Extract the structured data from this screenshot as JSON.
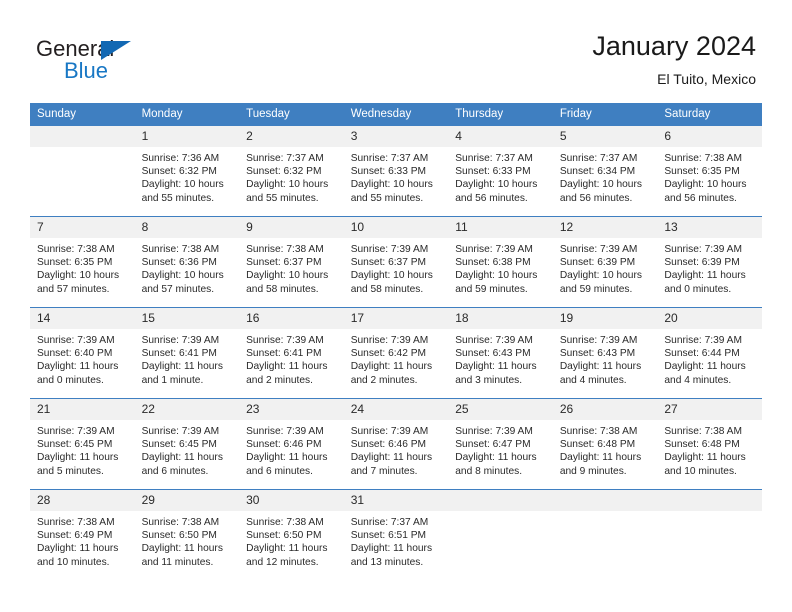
{
  "brand": {
    "name_top": "General",
    "name_bottom": "Blue",
    "color_dark": "#231f20",
    "color_blue": "#1877c4"
  },
  "header": {
    "title": "January 2024",
    "location": "El Tuito, Mexico"
  },
  "theme": {
    "header_row_bg": "#3f7fc1",
    "daynum_bg": "#f1f1f1",
    "text": "#2a2a2a"
  },
  "weekday_headers": [
    "Sunday",
    "Monday",
    "Tuesday",
    "Wednesday",
    "Thursday",
    "Friday",
    "Saturday"
  ],
  "weeks": [
    [
      {
        "day": "",
        "sunrise": "",
        "sunset": "",
        "daylight_line1": "",
        "daylight_line2": ""
      },
      {
        "day": "1",
        "sunrise": "Sunrise: 7:36 AM",
        "sunset": "Sunset: 6:32 PM",
        "daylight_line1": "Daylight: 10 hours",
        "daylight_line2": "and 55 minutes."
      },
      {
        "day": "2",
        "sunrise": "Sunrise: 7:37 AM",
        "sunset": "Sunset: 6:32 PM",
        "daylight_line1": "Daylight: 10 hours",
        "daylight_line2": "and 55 minutes."
      },
      {
        "day": "3",
        "sunrise": "Sunrise: 7:37 AM",
        "sunset": "Sunset: 6:33 PM",
        "daylight_line1": "Daylight: 10 hours",
        "daylight_line2": "and 55 minutes."
      },
      {
        "day": "4",
        "sunrise": "Sunrise: 7:37 AM",
        "sunset": "Sunset: 6:33 PM",
        "daylight_line1": "Daylight: 10 hours",
        "daylight_line2": "and 56 minutes."
      },
      {
        "day": "5",
        "sunrise": "Sunrise: 7:37 AM",
        "sunset": "Sunset: 6:34 PM",
        "daylight_line1": "Daylight: 10 hours",
        "daylight_line2": "and 56 minutes."
      },
      {
        "day": "6",
        "sunrise": "Sunrise: 7:38 AM",
        "sunset": "Sunset: 6:35 PM",
        "daylight_line1": "Daylight: 10 hours",
        "daylight_line2": "and 56 minutes."
      }
    ],
    [
      {
        "day": "7",
        "sunrise": "Sunrise: 7:38 AM",
        "sunset": "Sunset: 6:35 PM",
        "daylight_line1": "Daylight: 10 hours",
        "daylight_line2": "and 57 minutes."
      },
      {
        "day": "8",
        "sunrise": "Sunrise: 7:38 AM",
        "sunset": "Sunset: 6:36 PM",
        "daylight_line1": "Daylight: 10 hours",
        "daylight_line2": "and 57 minutes."
      },
      {
        "day": "9",
        "sunrise": "Sunrise: 7:38 AM",
        "sunset": "Sunset: 6:37 PM",
        "daylight_line1": "Daylight: 10 hours",
        "daylight_line2": "and 58 minutes."
      },
      {
        "day": "10",
        "sunrise": "Sunrise: 7:39 AM",
        "sunset": "Sunset: 6:37 PM",
        "daylight_line1": "Daylight: 10 hours",
        "daylight_line2": "and 58 minutes."
      },
      {
        "day": "11",
        "sunrise": "Sunrise: 7:39 AM",
        "sunset": "Sunset: 6:38 PM",
        "daylight_line1": "Daylight: 10 hours",
        "daylight_line2": "and 59 minutes."
      },
      {
        "day": "12",
        "sunrise": "Sunrise: 7:39 AM",
        "sunset": "Sunset: 6:39 PM",
        "daylight_line1": "Daylight: 10 hours",
        "daylight_line2": "and 59 minutes."
      },
      {
        "day": "13",
        "sunrise": "Sunrise: 7:39 AM",
        "sunset": "Sunset: 6:39 PM",
        "daylight_line1": "Daylight: 11 hours",
        "daylight_line2": "and 0 minutes."
      }
    ],
    [
      {
        "day": "14",
        "sunrise": "Sunrise: 7:39 AM",
        "sunset": "Sunset: 6:40 PM",
        "daylight_line1": "Daylight: 11 hours",
        "daylight_line2": "and 0 minutes."
      },
      {
        "day": "15",
        "sunrise": "Sunrise: 7:39 AM",
        "sunset": "Sunset: 6:41 PM",
        "daylight_line1": "Daylight: 11 hours",
        "daylight_line2": "and 1 minute."
      },
      {
        "day": "16",
        "sunrise": "Sunrise: 7:39 AM",
        "sunset": "Sunset: 6:41 PM",
        "daylight_line1": "Daylight: 11 hours",
        "daylight_line2": "and 2 minutes."
      },
      {
        "day": "17",
        "sunrise": "Sunrise: 7:39 AM",
        "sunset": "Sunset: 6:42 PM",
        "daylight_line1": "Daylight: 11 hours",
        "daylight_line2": "and 2 minutes."
      },
      {
        "day": "18",
        "sunrise": "Sunrise: 7:39 AM",
        "sunset": "Sunset: 6:43 PM",
        "daylight_line1": "Daylight: 11 hours",
        "daylight_line2": "and 3 minutes."
      },
      {
        "day": "19",
        "sunrise": "Sunrise: 7:39 AM",
        "sunset": "Sunset: 6:43 PM",
        "daylight_line1": "Daylight: 11 hours",
        "daylight_line2": "and 4 minutes."
      },
      {
        "day": "20",
        "sunrise": "Sunrise: 7:39 AM",
        "sunset": "Sunset: 6:44 PM",
        "daylight_line1": "Daylight: 11 hours",
        "daylight_line2": "and 4 minutes."
      }
    ],
    [
      {
        "day": "21",
        "sunrise": "Sunrise: 7:39 AM",
        "sunset": "Sunset: 6:45 PM",
        "daylight_line1": "Daylight: 11 hours",
        "daylight_line2": "and 5 minutes."
      },
      {
        "day": "22",
        "sunrise": "Sunrise: 7:39 AM",
        "sunset": "Sunset: 6:45 PM",
        "daylight_line1": "Daylight: 11 hours",
        "daylight_line2": "and 6 minutes."
      },
      {
        "day": "23",
        "sunrise": "Sunrise: 7:39 AM",
        "sunset": "Sunset: 6:46 PM",
        "daylight_line1": "Daylight: 11 hours",
        "daylight_line2": "and 6 minutes."
      },
      {
        "day": "24",
        "sunrise": "Sunrise: 7:39 AM",
        "sunset": "Sunset: 6:46 PM",
        "daylight_line1": "Daylight: 11 hours",
        "daylight_line2": "and 7 minutes."
      },
      {
        "day": "25",
        "sunrise": "Sunrise: 7:39 AM",
        "sunset": "Sunset: 6:47 PM",
        "daylight_line1": "Daylight: 11 hours",
        "daylight_line2": "and 8 minutes."
      },
      {
        "day": "26",
        "sunrise": "Sunrise: 7:38 AM",
        "sunset": "Sunset: 6:48 PM",
        "daylight_line1": "Daylight: 11 hours",
        "daylight_line2": "and 9 minutes."
      },
      {
        "day": "27",
        "sunrise": "Sunrise: 7:38 AM",
        "sunset": "Sunset: 6:48 PM",
        "daylight_line1": "Daylight: 11 hours",
        "daylight_line2": "and 10 minutes."
      }
    ],
    [
      {
        "day": "28",
        "sunrise": "Sunrise: 7:38 AM",
        "sunset": "Sunset: 6:49 PM",
        "daylight_line1": "Daylight: 11 hours",
        "daylight_line2": "and 10 minutes."
      },
      {
        "day": "29",
        "sunrise": "Sunrise: 7:38 AM",
        "sunset": "Sunset: 6:50 PM",
        "daylight_line1": "Daylight: 11 hours",
        "daylight_line2": "and 11 minutes."
      },
      {
        "day": "30",
        "sunrise": "Sunrise: 7:38 AM",
        "sunset": "Sunset: 6:50 PM",
        "daylight_line1": "Daylight: 11 hours",
        "daylight_line2": "and 12 minutes."
      },
      {
        "day": "31",
        "sunrise": "Sunrise: 7:37 AM",
        "sunset": "Sunset: 6:51 PM",
        "daylight_line1": "Daylight: 11 hours",
        "daylight_line2": "and 13 minutes."
      },
      {
        "day": "",
        "sunrise": "",
        "sunset": "",
        "daylight_line1": "",
        "daylight_line2": ""
      },
      {
        "day": "",
        "sunrise": "",
        "sunset": "",
        "daylight_line1": "",
        "daylight_line2": ""
      },
      {
        "day": "",
        "sunrise": "",
        "sunset": "",
        "daylight_line1": "",
        "daylight_line2": ""
      }
    ]
  ]
}
